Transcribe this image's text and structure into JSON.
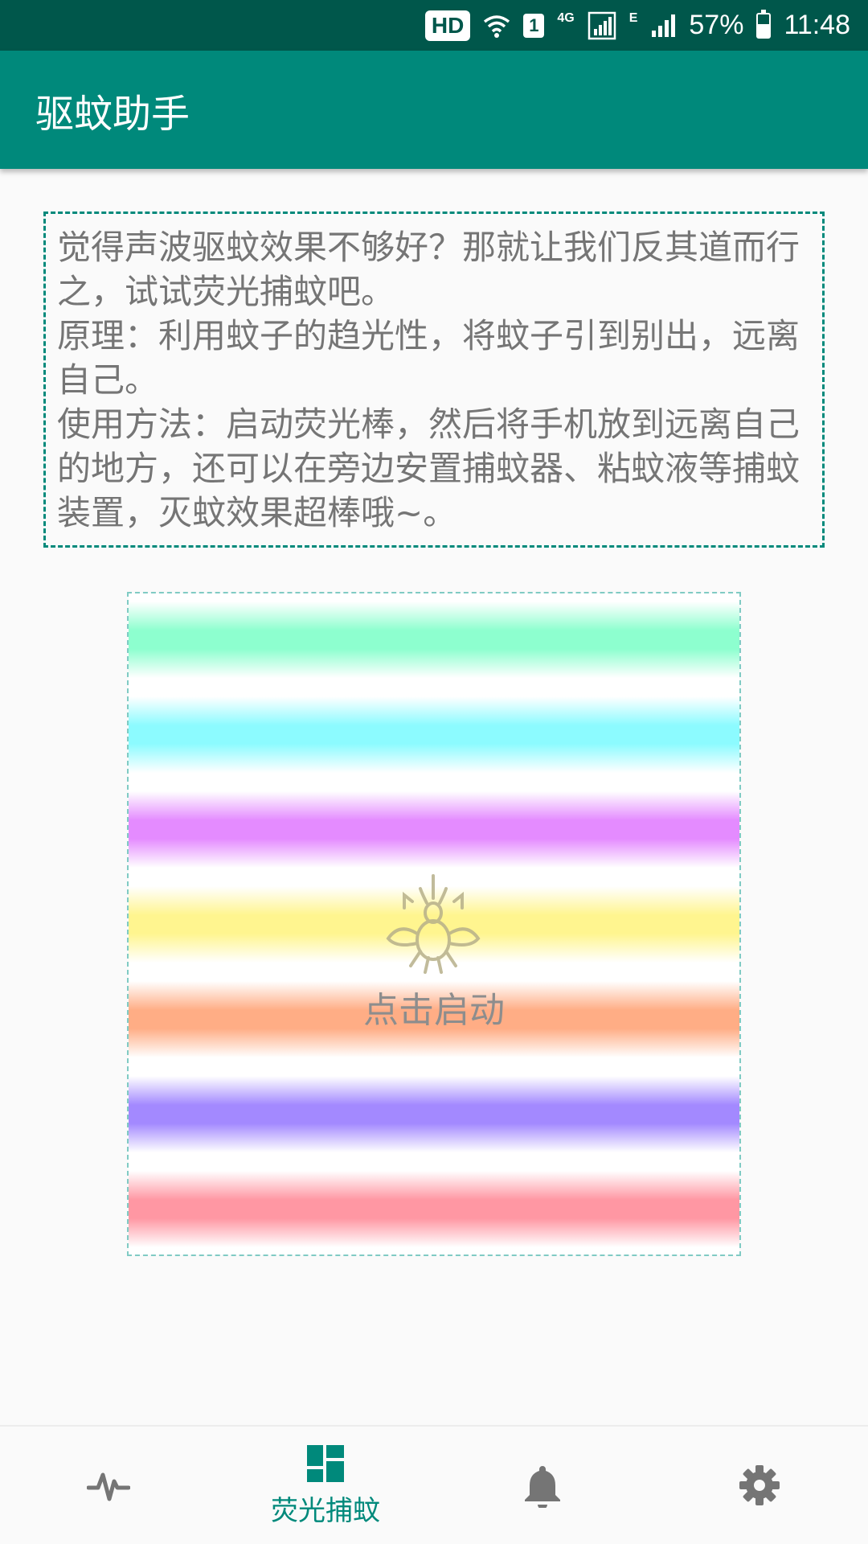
{
  "status_bar": {
    "hd_label": "HD",
    "sim_label": "1",
    "net_4g": "4G",
    "net_e": "E",
    "battery_text": "57%",
    "time": "11:48"
  },
  "app_bar": {
    "title": "驱蚊助手"
  },
  "description": {
    "paragraphs": [
      "觉得声波驱蚊效果不够好？那就让我们反其道而行之，试试荧光捕蚊吧。",
      "原理：利用蚊子的趋光性，将蚊子引到别出，远离自己。",
      "使用方法：启动荧光棒，然后将手机放到远离自己的地方，还可以在旁边安置捕蚊器、粘蚊液等捕蚊装置，灭蚊效果超棒哦~。"
    ]
  },
  "light_panel": {
    "start_label": "点击启动",
    "icon": "mosquito-icon",
    "stripe_colors": [
      "#8dffcf",
      "#8cfbff",
      "#e48bff",
      "#fff58f",
      "#ffad85",
      "#a389ff",
      "#ff97a3"
    ]
  },
  "bottom_nav": {
    "active_color": "#00897b",
    "inactive_color": "#757575",
    "items": [
      {
        "icon": "pulse-icon",
        "label": ""
      },
      {
        "icon": "dashboard-icon",
        "label": "荧光捕蚊"
      },
      {
        "icon": "bell-icon",
        "label": ""
      },
      {
        "icon": "gear-icon",
        "label": ""
      }
    ]
  }
}
